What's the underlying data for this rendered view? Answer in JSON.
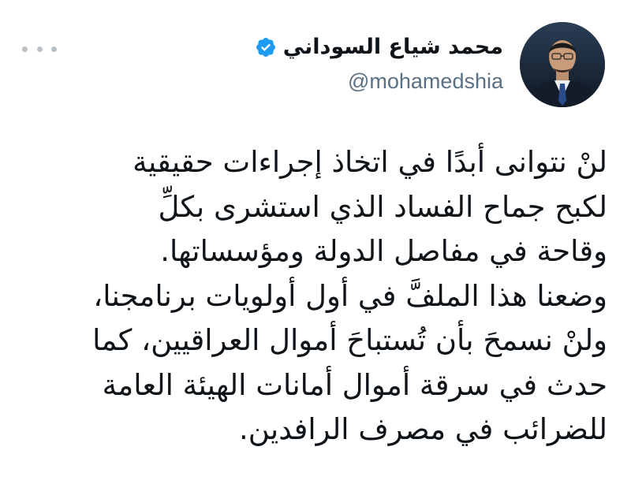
{
  "tweet": {
    "author": {
      "display_name": "محمد شياع السوداني",
      "handle": "@mohamedshia",
      "verified": true,
      "verified_icon": "verified-badge-icon",
      "avatar": "author-avatar-photo"
    },
    "more_icon": "more-options-icon",
    "text_lines": [
      "لنْ نتوانى أبدًا في اتخاذ إجراءات حقيقية",
      "لكبح جماح الفساد الذي استشرى بكلِّ",
      "وقاحة في مفاصل الدولة ومؤسساتها.",
      "وضعنا هذا الملفَّ في أول أولويات برنامجنا،",
      "ولنْ نسمحَ بأن تُستباحَ أموال العراقيين، كما",
      "حدث في سرقة أموال أمانات الهيئة العامة",
      "للضرائب في مصرف الرافدين."
    ]
  },
  "colors": {
    "verified_blue": "#1d9bf0",
    "text_primary": "#0f1419",
    "text_secondary": "#5b7083",
    "background": "#ffffff"
  }
}
